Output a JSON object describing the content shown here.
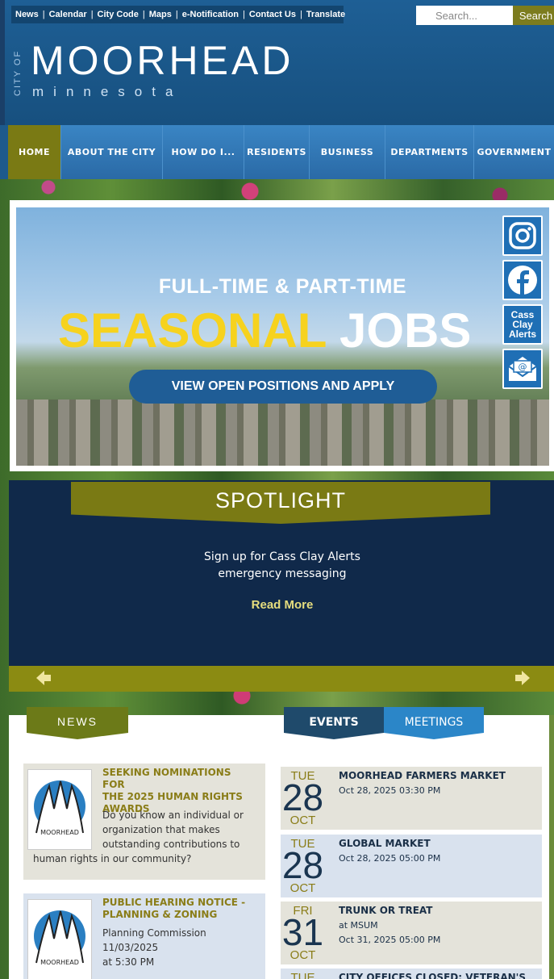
{
  "utility_nav": [
    "News",
    "Calendar",
    "City Code",
    "Maps",
    "e-Notification",
    "Contact Us",
    "Translate"
  ],
  "search": {
    "placeholder": "Search...",
    "button": "Search"
  },
  "logo": {
    "city_of": "CITY OF",
    "name": "MOORHEAD",
    "state": "minnesota"
  },
  "main_nav": [
    {
      "label": "HOME",
      "active": true
    },
    {
      "label": "ABOUT THE CITY",
      "active": false
    },
    {
      "label": "HOW DO I...",
      "active": false
    },
    {
      "label": "RESIDENTS",
      "active": false
    },
    {
      "label": "BUSINESS",
      "active": false
    },
    {
      "label": "DEPARTMENTS",
      "active": false
    },
    {
      "label": "GOVERNMENT",
      "active": false
    }
  ],
  "hero": {
    "line1": "FULL-TIME & PART-TIME",
    "line2_a": "SEASONAL",
    "line2_b": "JOBS",
    "cta": "VIEW OPEN POSITIONS AND APPLY"
  },
  "social": {
    "instagram": "instagram-icon",
    "facebook": "facebook-icon",
    "alerts_l1": "Cass",
    "alerts_l2": "Clay",
    "alerts_l3": "Alerts",
    "email": "email-icon"
  },
  "spotlight": {
    "title": "SPOTLIGHT",
    "text_l1": "Sign up for Cass Clay Alerts",
    "text_l2": "emergency messaging",
    "read_more": "Read More"
  },
  "tabs": {
    "news": "NEWS",
    "events": "EVENTS",
    "meetings": "MEETINGS"
  },
  "news": [
    {
      "title_l1": "SEEKING NOMINATIONS FOR",
      "title_l2": "THE 2025 HUMAN RIGHTS",
      "title_l3": "AWARDS",
      "desc_l1": "Do you know an individual or",
      "desc_l2": "organization that makes",
      "desc_l3": "outstanding contributions to",
      "desc_l4": "human rights in our community?",
      "thumb_label": "MOORHEAD"
    },
    {
      "title_l1": "PUBLIC HEARING NOTICE -",
      "title_l2": "PLANNING & ZONING",
      "desc_l1": "Planning Commission 11/03/2025",
      "desc_l2": "at 5:30 PM",
      "thumb_label": "MOORHEAD"
    }
  ],
  "events": [
    {
      "dow": "TUE",
      "day": "28",
      "mon": "OCT",
      "title": "MOORHEAD FARMERS MARKET",
      "line1": "Oct 28, 2025 03:30 PM",
      "line2": ""
    },
    {
      "dow": "TUE",
      "day": "28",
      "mon": "OCT",
      "title": "GLOBAL MARKET",
      "line1": "Oct 28, 2025 05:00 PM",
      "line2": ""
    },
    {
      "dow": "FRI",
      "day": "31",
      "mon": "OCT",
      "title": "TRUNK OR TREAT",
      "line1": "at MSUM",
      "line2": "Oct 31, 2025 05:00 PM"
    },
    {
      "dow": "TUE",
      "day": "",
      "mon": "",
      "title": "CITY OFFICES CLOSED: VETERAN'S",
      "line1": "",
      "line2": ""
    }
  ]
}
